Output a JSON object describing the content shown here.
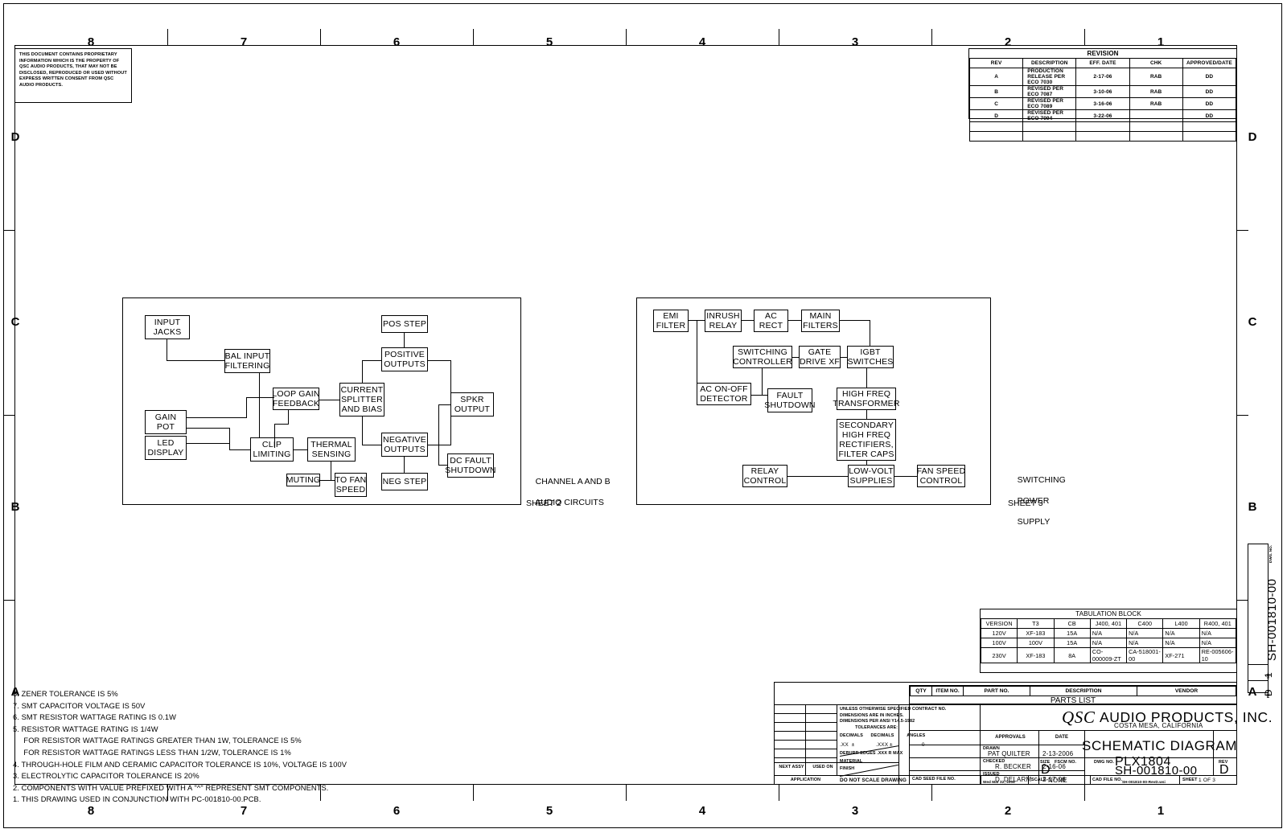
{
  "zones": {
    "columns": [
      "8",
      "7",
      "6",
      "5",
      "4",
      "3",
      "2",
      "1"
    ],
    "rows": [
      "D",
      "C",
      "B",
      "A"
    ]
  },
  "proprietary_notice": "THIS DOCUMENT CONTAINS PROPRIETARY\nINFORMATION WHICH IS THE PROPERTY\nOF QSC AUDIO PRODUCTS, THAT MAY NOT\nBE DISCLOSED, REPRODUCED OR USED\nWITHOUT EXPRESS WRITTEN CONSENT FROM\nQSC AUDIO PRODUCTS.",
  "revision_block": {
    "title": "REVISION",
    "headers": [
      "REV",
      "DESCRIPTION",
      "EFF. DATE",
      "CHK",
      "APPROVED/DATE"
    ],
    "rows": [
      {
        "rev": "A",
        "description": "PRODUCTION RELEASE PER ECO 7030",
        "eff_date": "2-17-06",
        "chk": "RAB",
        "approved": "DD"
      },
      {
        "rev": "B",
        "description": "REVISED PER ECO 7087",
        "eff_date": "3-10-06",
        "chk": "RAB",
        "approved": "DD"
      },
      {
        "rev": "C",
        "description": "REVISED PER ECO 7089",
        "eff_date": "3-16-06",
        "chk": "RAB",
        "approved": "DD"
      },
      {
        "rev": "D",
        "description": "REVISED PER ECO 7094",
        "eff_date": "3-22-06",
        "chk": "",
        "approved": "DD"
      },
      {
        "rev": "",
        "description": "",
        "eff_date": "",
        "chk": "",
        "approved": ""
      },
      {
        "rev": "",
        "description": "",
        "eff_date": "",
        "chk": "",
        "approved": ""
      }
    ]
  },
  "audio_diagram": {
    "caption_line1": "CHANNEL A AND B",
    "caption_line2": "AUDIO CIRCUITS",
    "sheet": "SHEET 2",
    "blocks": {
      "input_jacks": "INPUT\nJACKS",
      "bal_input_filtering": "BAL INPUT\nFILTERING",
      "gain_pot": "GAIN\nPOT",
      "led_display": "LED\nDISPLAY",
      "loop_gain_feedback": "LOOP GAIN\nFEEDBACK",
      "clip_limiting": "CLIP\nLIMITING",
      "thermal_sensing": "THERMAL\nSENSING",
      "muting": "MUTING",
      "to_fan_speed": "TO FAN\nSPEED",
      "current_splitter": "CURRENT\nSPLITTER\nAND BIAS",
      "pos_step": "POS STEP",
      "positive_outputs": "POSITIVE\nOUTPUTS",
      "negative_outputs": "NEGATIVE\nOUTPUTS",
      "neg_step": "NEG STEP",
      "spkr_output": "SPKR\nOUTPUT",
      "dc_fault_shutdown": "DC FAULT\nSHUTDOWN"
    }
  },
  "psu_diagram": {
    "caption_line1": "SWITCHING",
    "caption_line2": "POWER",
    "caption_line3": "SUPPLY",
    "sheet": "SHEET 3",
    "blocks": {
      "emi_filter": "EMI\nFILTER",
      "inrush_relay": "INRUSH\nRELAY",
      "ac_rect": "AC\nRECT",
      "main_filters": "MAIN\nFILTERS",
      "switching_controller": "SWITCHING\nCONTROLLER",
      "gate_drive_xf": "GATE\nDRIVE XF",
      "igbt_switches": "IGBT\nSWITCHES",
      "ac_on_off_detector": "AC ON-OFF\nDETECTOR",
      "fault_shutdown": "FAULT\nSHUTDOWN",
      "high_freq_transformer": "HIGH FREQ\nTRANSFORMER",
      "secondary_rectifiers": "SECONDARY\nHIGH FREQ\nRECTIFIERS,\nFILTER CAPS",
      "relay_control": "RELAY\nCONTROL",
      "low_volt_supplies": "LOW-VOLT\nSUPPLIES",
      "fan_speed_control": "FAN SPEED\nCONTROL"
    }
  },
  "tabulation_block": {
    "title": "TABULATION BLOCK",
    "headers": [
      "VERSION",
      "T3",
      "CB",
      "J400, 401",
      "C400",
      "L400",
      "R400, 401"
    ],
    "rows": [
      [
        "120V",
        "XF-183",
        "15A",
        "N/A",
        "N/A",
        "N/A",
        "N/A"
      ],
      [
        "100V",
        "100V",
        "15A",
        "N/A",
        "N/A",
        "N/A",
        "N/A"
      ],
      [
        "230V",
        "XF-183",
        "8A",
        "CO-000009-ZT",
        "CA-518001-00",
        "XF-271",
        "RE-005606-10"
      ]
    ]
  },
  "parts_list": {
    "headers": [
      "QTY",
      "ITEM NO.",
      "PART NO.",
      "DESCRIPTION",
      "VENDOR"
    ],
    "title": "PARTS LIST"
  },
  "notes": [
    "8. ZENER TOLERANCE IS 5%",
    "7. SMT CAPACITOR VOLTAGE IS 50V",
    "6. SMT RESISTOR WATTAGE RATING IS 0.1W",
    "5. RESISTOR WATTAGE RATING IS 1/4W",
    "     FOR RESISTOR WATTAGE RATINGS GREATER THAN 1W, TOLERANCE IS 5%",
    "     FOR RESISTOR WATTAGE RATINGS LESS THAN 1/2W, TOLERANCE IS 1%",
    "4. THROUGH-HOLE FILM AND CERAMIC CAPACITOR TOLERANCE IS 10%, VOLTAGE IS 100V",
    "3. ELECTROLYTIC CAPACITOR TOLERANCE IS 20%",
    "2. COMPONENTS WITH VALUE PREFIXED WITH A \"^\" REPRESENT SMT COMPONENTS.",
    "1. THIS DRAWING USED IN CONJUNCTION WITH PC-001810-00.PCB."
  ],
  "title_block": {
    "contract_no_label": "CONTRACT NO.",
    "company_logo": "QSC",
    "company_name": "AUDIO PRODUCTS, INC.",
    "company_city": "COSTA MESA, CALIFORNIA",
    "drawing_title": "SCHEMATIC DIAGRAM",
    "drawing_model": "PLX1804",
    "tolerance_note": "UNLESS OTHERWISE SPECIFIED\nDIMENSIONS ARE IN INCHES.\nDIMENSIONS PER ANSI Y14.5-1982\n            TOLERANCES ARE:",
    "decimals_label": "DECIMALS      DECIMALS          ANGLES",
    "decimals_values": ".XX  ±              .XXX ±                   0",
    "deburr": "DEBURR EDGES .XXX R MAX",
    "material_label": "MATERIAL",
    "finish_label": "FINISH",
    "next_assy": "NEXT ASSY",
    "used_on": "USED ON",
    "application": "APPLICATION",
    "do_not_scale": "DO NOT SCALE DRAWING",
    "approvals_label": "APPROVALS",
    "date_label": "DATE",
    "drawn_label": "DRAWN",
    "drawn_by": "PAT QUILTER",
    "drawn_date": "2-13-2006",
    "checked_label": "CHECKED",
    "checked_by": "R. BECKER",
    "checked_date": "2-16-06",
    "issued_label": "ISSUED",
    "issued_by": "D. DELARM",
    "issued_date": "2-17-06",
    "cad_seed_label": "CAD SEED FILE NO.",
    "cad_seed_value": "Wed Mar 22, 2006",
    "size_label": "SIZE",
    "size_value": "D",
    "fscm_label": "FSCM NO.",
    "fscm_value": "",
    "dwg_no_label": "DWG NO.",
    "dwg_no_value": "SH-001810-00",
    "rev_label": "REV",
    "rev_value": "D",
    "scale_label": "SCALE",
    "scale_value": "NONE",
    "cad_file_label": "CAD FILE NO.",
    "cad_file_value": "SH-001810-00-RevD.wsi",
    "sheet_label": "SHEET",
    "sheet_value": "1  OF  3"
  },
  "edge_marks": {
    "dwg_no_label": "DWG. NO.",
    "dwg_no": "SH-001810-00",
    "sheet_label": "SH",
    "sheet_no": "1",
    "rev_label": "REV",
    "rev": "D"
  }
}
